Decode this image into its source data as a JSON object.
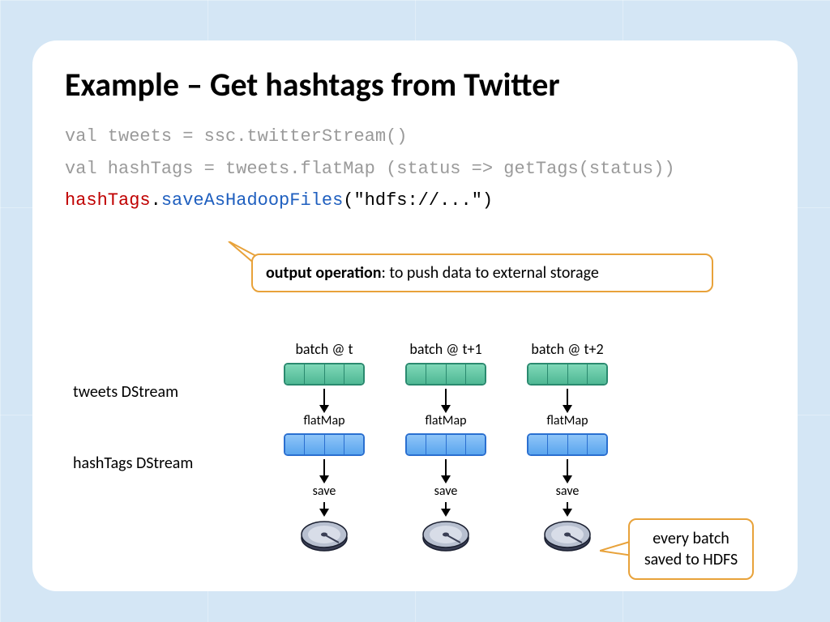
{
  "title": "Example – Get hashtags from Twitter",
  "code": {
    "line1": "val tweets = ssc.twitterStream()",
    "line2": "val hashTags = tweets.flatMap (status => getTags(status))",
    "line3_a": "hashTags",
    "line3_dot": ".",
    "line3_b": "saveAsHadoopFiles",
    "line3_c": "(\"hdfs://...\")"
  },
  "callout1_bold": "output operation",
  "callout1_rest": ": to push data to external storage",
  "callout2": "every batch saved to HDFS",
  "labels": {
    "tweets": "tweets DStream",
    "hashtags": "hashTags DStream"
  },
  "columns": [
    {
      "batch": "batch @ t",
      "op1": "flatMap",
      "op2": "save"
    },
    {
      "batch": "batch @ t+1",
      "op1": "flatMap",
      "op2": "save"
    },
    {
      "batch": "batch @ t+2",
      "op1": "flatMap",
      "op2": "save"
    }
  ]
}
